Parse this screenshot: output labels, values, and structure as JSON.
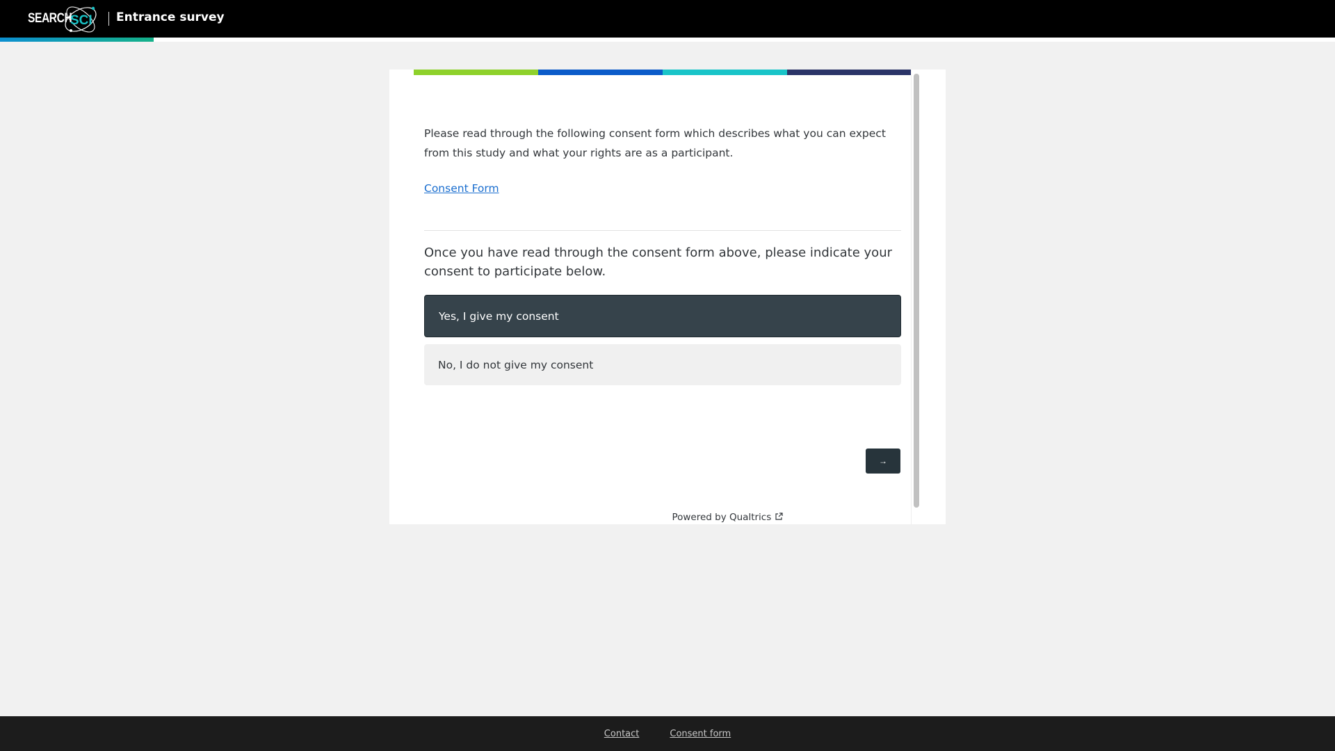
{
  "header": {
    "logo_text": "SEARCH",
    "logo_mark": "SCI",
    "title": "Entrance survey",
    "progress_fraction": 0.115
  },
  "card": {
    "stripe_colors": [
      "#8ed12b",
      "#0b5bc9",
      "#19c4c8",
      "#2b3468"
    ],
    "intro_text": "Please read through the following consent form which describes what you can expect from this study and what your rights are as a participant.",
    "consent_link": "Consent Form",
    "question": "Once you have read through the consent form above, please indicate your consent to participate below.",
    "choices": [
      {
        "label": "Yes, I give my consent",
        "selected": true
      },
      {
        "label": "No, I do not give my consent",
        "selected": false
      }
    ],
    "next_button": "→",
    "powered_by": "Powered by Qualtrics",
    "powered_icon": "external-link-icon"
  },
  "footer": {
    "links": [
      "Contact",
      "Consent form"
    ]
  },
  "colors": {
    "header_bg": "#000000",
    "selected_choice": "#36434b",
    "link": "#1a6ecf"
  }
}
